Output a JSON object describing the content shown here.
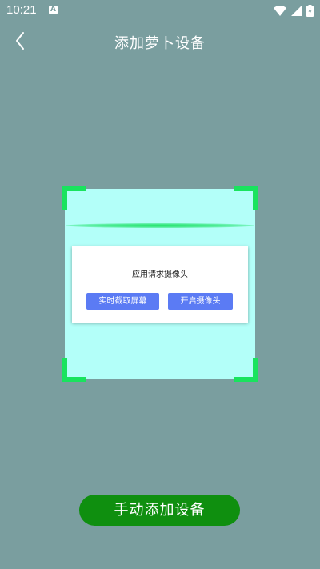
{
  "status_bar": {
    "time": "10:21",
    "notification_icon": "a-icon",
    "icons": [
      "wifi-icon",
      "signal-icon",
      "battery-icon"
    ]
  },
  "header": {
    "title": "添加萝卜设备",
    "back_icon": "chevron-left-icon"
  },
  "scanner": {
    "frame_color": "#19e35e",
    "background_color": "#b3fff9"
  },
  "dialog": {
    "title": "应用请求摄像头",
    "left_button_label": "实时截取屏幕",
    "right_button_label": "开启摄像头",
    "button_color": "#5b7bf4"
  },
  "footer": {
    "manual_add_label": "手动添加设备",
    "button_color": "#0f8f0f"
  },
  "colors": {
    "background": "#7a9e9f"
  }
}
